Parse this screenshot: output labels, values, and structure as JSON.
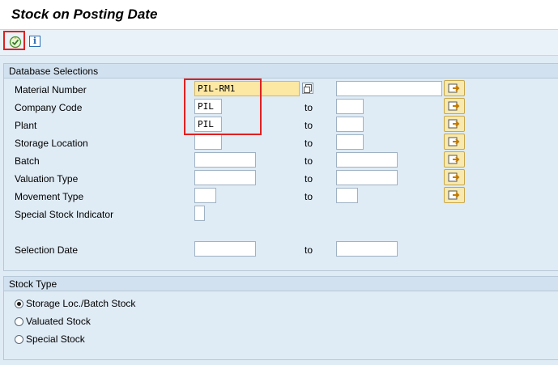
{
  "title": "Stock on Posting Date",
  "toolbar": {
    "execute_icon": "execute-icon",
    "info_icon": "info-icon",
    "info_glyph": "i"
  },
  "database_selections": {
    "header": "Database Selections",
    "to_label": "to",
    "rows": [
      {
        "label": "Material Number",
        "from": "PIL-RM1",
        "to": ""
      },
      {
        "label": "Company Code",
        "from": "PIL",
        "to": ""
      },
      {
        "label": "Plant",
        "from": "PIL",
        "to": ""
      },
      {
        "label": "Storage Location",
        "from": "",
        "to": ""
      },
      {
        "label": "Batch",
        "from": "",
        "to": ""
      },
      {
        "label": "Valuation Type",
        "from": "",
        "to": ""
      },
      {
        "label": "Movement Type",
        "from": "",
        "to": ""
      },
      {
        "label": "Special Stock Indicator",
        "from": ""
      },
      {
        "label": "Selection Date",
        "from": "",
        "to": ""
      }
    ]
  },
  "stock_type": {
    "header": "Stock Type",
    "options": [
      {
        "label": "Storage Loc./Batch Stock",
        "selected": true
      },
      {
        "label": "Valuated Stock",
        "selected": false
      },
      {
        "label": "Special Stock",
        "selected": false
      }
    ]
  },
  "colors": {
    "highlight": "#e02020",
    "active_field": "#fce8a3",
    "background": "#dfebf5"
  }
}
